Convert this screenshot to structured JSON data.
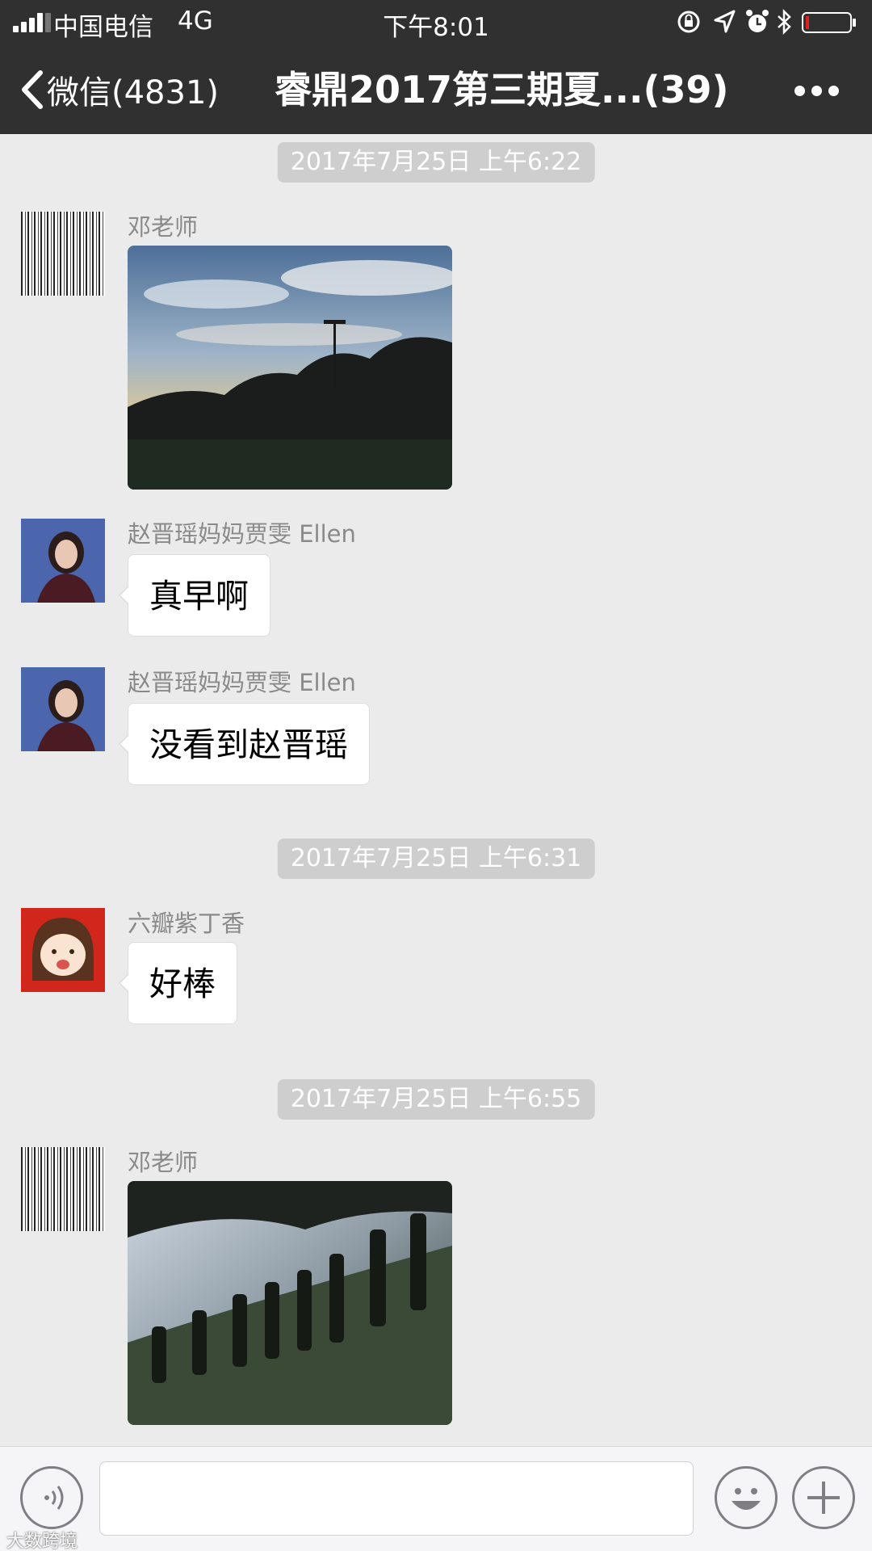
{
  "status_bar": {
    "carrier": "中国电信",
    "network": "4G",
    "time": "下午8:01",
    "icons": [
      "orientation-lock-icon",
      "location-arrow-icon",
      "alarm-icon",
      "bluetooth-icon",
      "battery-low-icon"
    ]
  },
  "nav": {
    "back_label": "微信(4831)",
    "title": "睿鼎2017第三期夏...(39)",
    "more_icon": "more-dots-icon"
  },
  "chat": {
    "timestamps": [
      "2017年7月25日 上午6:22",
      "2017年7月25日 上午6:31",
      "2017年7月25日 上午6:55"
    ],
    "messages": [
      {
        "sender": "邓老师",
        "type": "image",
        "description_icon": "photo-sunrise-field"
      },
      {
        "sender": "赵晋瑶妈妈贾雯 Ellen",
        "type": "text",
        "text": "真早啊"
      },
      {
        "sender": "赵晋瑶妈妈贾雯 Ellen",
        "type": "text",
        "text": "没看到赵晋瑶"
      },
      {
        "sender": "六瓣紫丁香",
        "type": "text",
        "text": "好棒"
      },
      {
        "sender": "邓老师",
        "type": "image",
        "description_icon": "photo-marching-students"
      }
    ]
  },
  "input_bar": {
    "voice_icon": "voice-icon",
    "input_value": "",
    "emoji_icon": "emoji-icon",
    "plus_icon": "plus-icon"
  },
  "watermark": "大数跨境",
  "colors": {
    "header_bg": "#303030",
    "chat_bg": "#ebebeb",
    "timestamp_bg": "#cecece",
    "bubble_bg": "#ffffff",
    "sender_text": "#8a8a8a"
  }
}
